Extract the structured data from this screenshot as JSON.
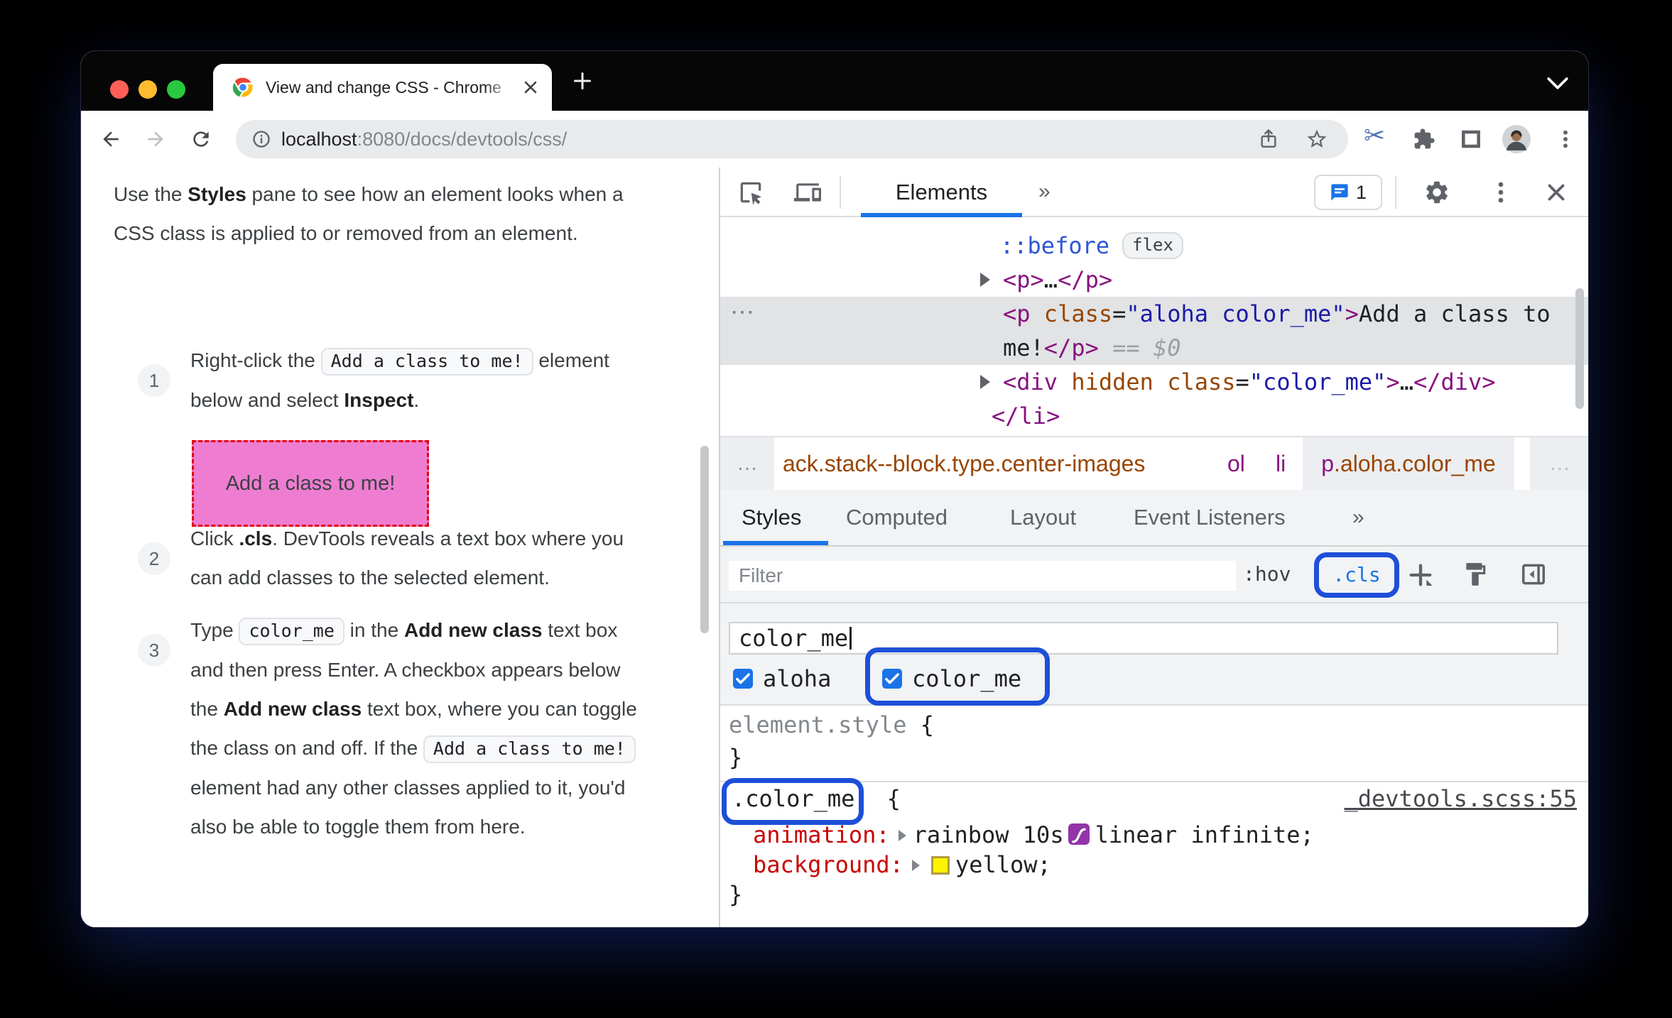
{
  "colors": {
    "accent_blue": "#1a73e8",
    "annotation_ring_blue": "#1d4fd8",
    "checkbox_blue": "#1a73e8",
    "dom_selection_gray": "#e1e3e5",
    "demo_box_pink": "#ee7dd2",
    "demo_box_border_red": "#e60000",
    "swatch_yellow": "#fdf303",
    "bezier_purple": "#9334a8",
    "tag_purple": "#881280",
    "attr_orange": "#994500",
    "value_blue": "#1a1aa6",
    "property_red": "#c80000",
    "traffic_red": "#ff5f57",
    "traffic_yellow": "#febc2e",
    "traffic_green": "#28c840"
  },
  "browser": {
    "tab": {
      "title": "View and change CSS - Chrome "
    },
    "toolbar": {
      "url_host": "localhost",
      "url_path": ":8080/docs/devtools/css/"
    }
  },
  "doc": {
    "intro": [
      {
        "t": "text",
        "s": "Use the "
      },
      {
        "t": "bold",
        "s": "Styles"
      },
      {
        "t": "text",
        "s": " pane to see how an element looks when a CSS class is applied to or removed from an element."
      }
    ],
    "steps": [
      {
        "num": "1",
        "body": [
          {
            "t": "text",
            "s": "Right-click the "
          },
          {
            "t": "code",
            "s": "Add a class to me!"
          },
          {
            "t": "text",
            "s": " element below and select "
          },
          {
            "t": "bold",
            "s": "Inspect"
          },
          {
            "t": "text",
            "s": "."
          }
        ]
      },
      {
        "num": "2",
        "body": [
          {
            "t": "text",
            "s": "Click "
          },
          {
            "t": "bold",
            "s": ".cls"
          },
          {
            "t": "text",
            "s": ". DevTools reveals a text box where you can add classes to the selected element."
          }
        ]
      },
      {
        "num": "3",
        "body": [
          {
            "t": "text",
            "s": "Type "
          },
          {
            "t": "code",
            "s": "color_me"
          },
          {
            "t": "text",
            "s": " in the "
          },
          {
            "t": "bold",
            "s": "Add new class"
          },
          {
            "t": "text",
            "s": " text box and then press Enter. A checkbox appears below the "
          },
          {
            "t": "bold",
            "s": "Add new class"
          },
          {
            "t": "text",
            "s": " text box, where you can toggle the class on and off. If the "
          },
          {
            "t": "code",
            "s": "Add a class to me!"
          },
          {
            "t": "text",
            "s": " element had any other classes applied to it, you'd also be able to toggle them from here."
          }
        ]
      }
    ],
    "demo_box": {
      "label": "Add a class to me!"
    }
  },
  "devtools": {
    "toolbar": {
      "panel_tab": "Elements",
      "more": "»",
      "messages_count": "1"
    },
    "dom": {
      "overflow_dots": "⋯",
      "flex_badge": "flex",
      "rows": {
        "pseudo": [
          {
            "c": "pseudo",
            "s": "::before"
          }
        ],
        "p_collapsed": [
          {
            "c": "tag",
            "s": "<p>"
          },
          {
            "c": "text",
            "s": "…"
          },
          {
            "c": "tag",
            "s": "</p>"
          }
        ],
        "selected_line1": [
          {
            "c": "tag",
            "s": "<p"
          },
          {
            "c": "attr",
            "s": " class"
          },
          {
            "c": "text",
            "s": "="
          },
          {
            "c": "val",
            "s": "\"aloha color_me\""
          },
          {
            "c": "tag",
            "s": ">"
          },
          {
            "c": "text",
            "s": "Add a class to"
          }
        ],
        "selected_line2": [
          {
            "c": "text",
            "s": "me!"
          },
          {
            "c": "tag",
            "s": "</p>"
          },
          {
            "c": "eq",
            "s": " == "
          },
          {
            "c": "dollar",
            "s": "$0"
          }
        ],
        "div_hidden": [
          {
            "c": "tag",
            "s": "<div"
          },
          {
            "c": "attr",
            "s": " hidden class"
          },
          {
            "c": "text",
            "s": "="
          },
          {
            "c": "val",
            "s": "\"color_me\""
          },
          {
            "c": "tag",
            "s": ">"
          },
          {
            "c": "text",
            "s": "…"
          },
          {
            "c": "tag",
            "s": "</div>"
          }
        ],
        "li_close": [
          {
            "c": "tag",
            "s": "</li>"
          }
        ]
      }
    },
    "breadcrumb": {
      "more_left": "…",
      "crumb_stack": [
        {
          "c": "attr",
          "s": "ack.stack--block.type.center-images"
        }
      ],
      "crumb_ol": [
        {
          "c": "tag",
          "s": "ol"
        }
      ],
      "crumb_li": [
        {
          "c": "tag",
          "s": "li"
        }
      ],
      "crumb_selected": [
        {
          "c": "tag",
          "s": "p"
        },
        {
          "c": "attr",
          "s": ".aloha.color_me"
        }
      ],
      "more_right": "…"
    },
    "sidebar_tabs": {
      "styles": "Styles",
      "computed": "Computed",
      "layout": "Layout",
      "event_listeners": "Event Listeners",
      "more": "»"
    },
    "filter": {
      "placeholder": "Filter",
      "pseudo_toggle": ":hov",
      "class_toggle": ".cls"
    },
    "class_editor": {
      "value": "color_me",
      "checkboxes": {
        "first": "aloha",
        "second": "color_me"
      }
    },
    "rules": {
      "element_style": {
        "selector": "element.style",
        "open": " {",
        "close": "}"
      },
      "color_me": {
        "selector": ".color_me",
        "open": "{",
        "source": "_devtools.scss:55",
        "anim_property": "animation:",
        "anim_value_a": "rainbow 10s",
        "anim_value_b": "linear infinite;",
        "bg_property": "background:",
        "bg_value": "yellow;",
        "close": "}"
      }
    }
  }
}
